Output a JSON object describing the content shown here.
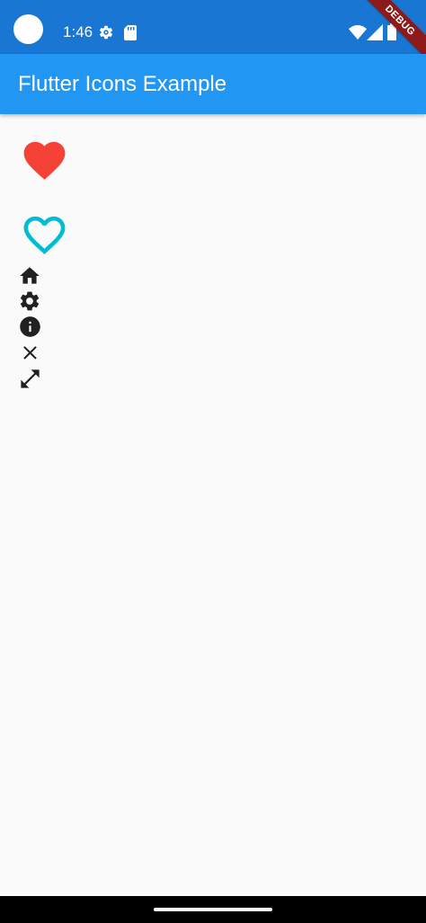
{
  "status_bar": {
    "time": "1:46",
    "icons": [
      "avatar",
      "gear-icon",
      "sd-card-icon",
      "wifi-icon",
      "signal-icon",
      "battery-icon"
    ],
    "background": "#1976d2"
  },
  "debug_banner": {
    "label": "DEBUG",
    "color": "#8b1a1a"
  },
  "app_bar": {
    "title": "Flutter Icons Example",
    "background": "#2196f3"
  },
  "icons": [
    {
      "name": "favorite-icon",
      "style": "filled",
      "color": "#f44336"
    },
    {
      "name": "favorite-border-icon",
      "style": "outlined",
      "color": "#00bcd4"
    },
    {
      "name": "home-icon",
      "color": "#212121"
    },
    {
      "name": "settings-icon",
      "color": "#212121"
    },
    {
      "name": "info-icon",
      "color": "#212121"
    },
    {
      "name": "close-icon",
      "color": "#212121"
    },
    {
      "name": "open-in-full-icon",
      "color": "#212121"
    }
  ],
  "nav_bar": {
    "background": "#000000"
  }
}
